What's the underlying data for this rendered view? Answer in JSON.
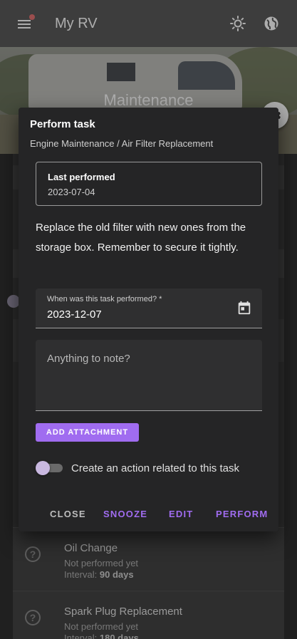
{
  "app_bar": {
    "title": "My RV"
  },
  "hero": {
    "title": "Maintenance"
  },
  "dialog": {
    "title": "Perform task",
    "path": "Engine Maintenance / Air Filter Replacement",
    "last_performed_label": "Last performed",
    "last_performed_date": "2023-07-04",
    "instructions": "Replace the old filter with new ones from the storage box. Remember to secure it tightly.",
    "date_field": {
      "label": "When was this task performed? *",
      "value": "2023-12-07"
    },
    "note_field": {
      "placeholder": "Anything to note?"
    },
    "attach_button": "ADD ATTACHMENT",
    "toggle_label": "Create an action related to this task",
    "toggle_on": false,
    "actions": {
      "close": "CLOSE",
      "snooze": "SNOOZE",
      "edit": "EDIT",
      "perform": "PERFORM"
    }
  },
  "list_items": [
    {
      "title": "Oil Change",
      "status": "Not performed yet",
      "interval_label": "Interval:",
      "interval_value": "90 days"
    },
    {
      "title": "Spark Plug Replacement",
      "status": "Not performed yet",
      "interval_label": "Interval:",
      "interval_value": "180 days"
    }
  ],
  "colors": {
    "accent": "#a06cf0",
    "app_bar": "#5b5b5b",
    "dialog_bg": "#252526"
  }
}
